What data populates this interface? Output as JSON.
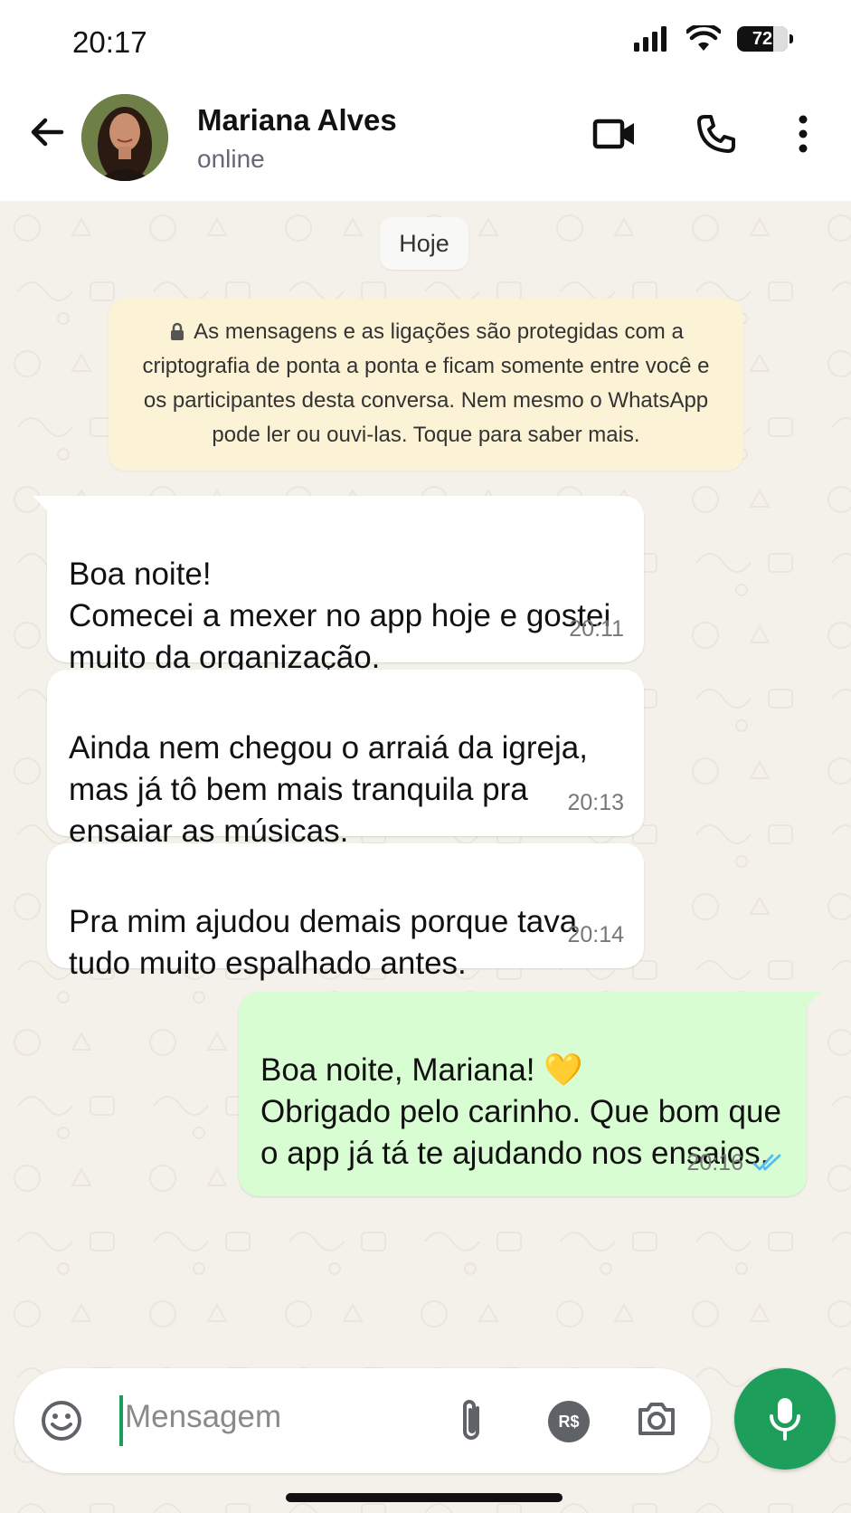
{
  "status_bar": {
    "time": "20:17",
    "battery": "72",
    "battery_level": 0.72
  },
  "header": {
    "contact_name": "Mariana Alves",
    "status": "online",
    "icons": [
      "back-arrow-icon",
      "video-call-icon",
      "phone-icon",
      "more-vertical-icon"
    ]
  },
  "chat": {
    "date_chip": "Hoje",
    "encryption_notice": "As mensagens e as ligações são protegidas com a criptografia de ponta a ponta e ficam somente entre você e os participantes desta conversa. Nem mesmo o WhatsApp pode ler ou ouvi-las. Toque para saber mais.",
    "messages": [
      {
        "direction": "in",
        "text": "Boa noite!\nComecei a mexer no app hoje e gostei muito da organização.",
        "time": "20:11"
      },
      {
        "direction": "in",
        "text": "Ainda nem chegou o arraiá da igreja, mas já tô bem mais tranquila pra ensaiar as músicas.",
        "time": "20:13"
      },
      {
        "direction": "in",
        "text": "Pra mim ajudou demais porque tava tudo muito espalhado antes.",
        "time": "20:14"
      },
      {
        "direction": "out",
        "text": "Boa noite, Mariana! 💛\nObrigado pelo carinho. Que bom que o app já tá te ajudando nos ensaios.",
        "time": "20:16",
        "read": true
      }
    ]
  },
  "composer": {
    "placeholder": "Mensagem",
    "currency_button": "R$"
  },
  "colors": {
    "accent": "#1d9f5b",
    "outgoing_bubble": "#d9fdd3",
    "incoming_bubble": "#ffffff",
    "read_ticks": "#53bdeb",
    "notice_bg": "#fcf3d6"
  }
}
